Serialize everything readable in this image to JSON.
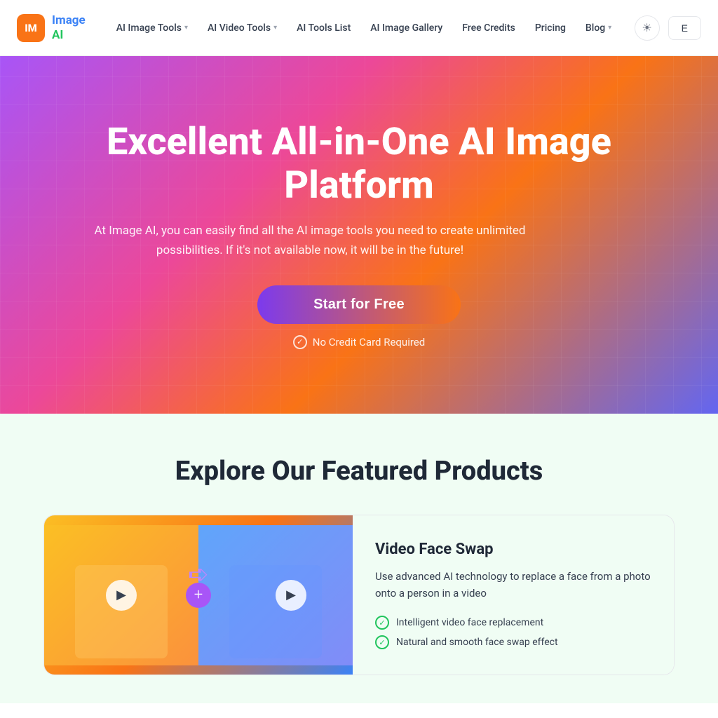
{
  "nav": {
    "logo": {
      "icon_text": "IM",
      "name_line1": "Image",
      "name_line2": "AI"
    },
    "items": [
      {
        "label": "AI Image Tools",
        "has_chevron": true
      },
      {
        "label": "AI Video Tools",
        "has_chevron": true
      },
      {
        "label": "AI Tools List",
        "has_chevron": false
      },
      {
        "label": "AI Image Gallery",
        "has_chevron": false
      },
      {
        "label": "Free Credits",
        "has_chevron": false
      },
      {
        "label": "Pricing",
        "has_chevron": false
      },
      {
        "label": "Blog",
        "has_chevron": true
      }
    ],
    "theme_icon": "☀",
    "sign_button": "E"
  },
  "hero": {
    "title": "Excellent All-in-One AI Image Platform",
    "subtitle": "At Image AI, you can easily find all the AI image tools you need to create unlimited possibilities. If it's not available now, it will be in the future!",
    "cta_label": "Start for Free",
    "no_cc_text": "No Credit Card Required"
  },
  "products": {
    "section_title": "Explore Our Featured Products",
    "card": {
      "name": "Video Face Swap",
      "description": "Use advanced AI technology to replace a face from a photo onto a person in a video",
      "features": [
        "Intelligent video face replacement",
        "Natural and smooth face swap effect"
      ]
    }
  }
}
